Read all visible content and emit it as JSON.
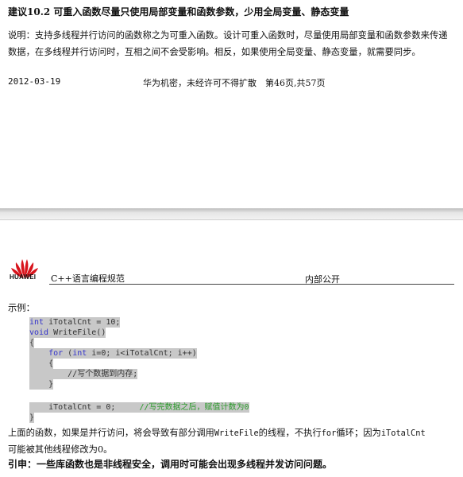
{
  "page1": {
    "heading": "建议10.2 可重入函数尽量只使用局部变量和函数参数，少用全局变量、静态变量",
    "description": "说明：支持多线程并行访问的函数称之为可重入函数。设计可重入函数时，尽量使用局部变量和函数参数来传递数据，在多线程并行访问时，互相之间不会受影响。相反，如果使用全局变量、静态变量，就需要同步。",
    "footer_date": "2012-03-19",
    "footer_confidential": "华为机密，未经许可不得扩散　第46页,共57页"
  },
  "page2": {
    "logo_text": "HUAWEI",
    "header_title": "C++语言编程规范",
    "header_public": "内部公开",
    "example_label": "示例：",
    "code": {
      "l1_kw": "int",
      "l1_rest": " iTotalCnt = 10;",
      "l2_kw": "void",
      "l2_rest": " WriteFile()",
      "l3": "{",
      "l4_indent": "    ",
      "l4_kw1": "for",
      "l4_mid1": " (",
      "l4_kw2": "int",
      "l4_rest": " i=0; i<iTotalCnt; i++)",
      "l5": "    {",
      "l6_indent": "        ",
      "l6_comment": "//写个数据到内存;",
      "l7": "    }",
      "l8_code": "    iTotalCnt = 0;     ",
      "l8_comment": "//写完数据之后，赋值计数为0",
      "l9": "}"
    },
    "explanation_a": "上面的函数，如果是并行访问，将会导致有部分调用",
    "explanation_code1": "WriteFile",
    "explanation_b": "的线程，不执行",
    "explanation_code2": "for",
    "explanation_c": "循环；因为",
    "explanation_code3": "iTotalCnt",
    "explanation_d": "可能被其他线程修改为0。",
    "warning": "引申：一些库函数也是非线程安全，调用时可能会出现多线程并发访问问题。"
  },
  "colors": {
    "keyword": "#3333cc",
    "comment": "#2a9a2a",
    "code_bg": "#c8c8c8",
    "logo_red": "#d8141c"
  }
}
